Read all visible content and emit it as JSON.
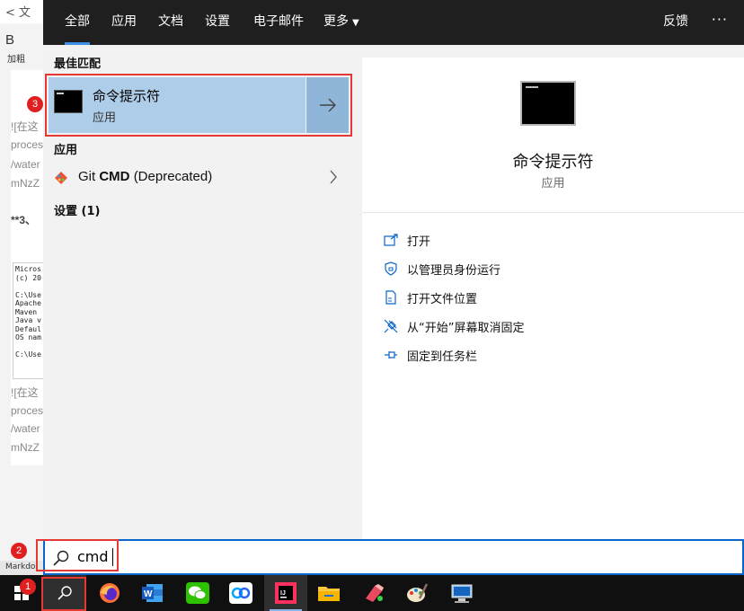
{
  "background_editor": {
    "top_fragment": "< 文",
    "bold_button": "B",
    "bold_label": "加粗",
    "lines": [
      "![在这",
      "proces",
      "/water",
      "mNzZ"
    ],
    "heading_fragment": "**3、",
    "terminal_lines": [
      "Micros",
      "(c) 20",
      "",
      "C:\\Use",
      "Apache",
      "Maven",
      "Java v",
      "Defaul",
      "OS nam",
      "",
      "C:\\Use"
    ],
    "lines_2": [
      "![在这",
      "proces",
      "/water",
      "mNzZ"
    ],
    "status_text": "Markdo"
  },
  "tabs": [
    {
      "label": "全部",
      "active": true
    },
    {
      "label": "应用"
    },
    {
      "label": "文档"
    },
    {
      "label": "设置"
    },
    {
      "label": "电子邮件"
    },
    {
      "label": "更多"
    }
  ],
  "feedback_label": "反馈",
  "more_options": "···",
  "best_match": {
    "heading": "最佳匹配",
    "title": "命令提示符",
    "subtitle": "应用"
  },
  "apps_section": {
    "heading": "应用",
    "item_name": "Git",
    "item_bold": "CMD",
    "item_suffix": "(Deprecated)"
  },
  "settings_section": {
    "heading": "设置 (1)"
  },
  "details": {
    "title": "命令提示符",
    "subtitle": "应用",
    "actions": [
      {
        "label": "打开",
        "icon": "open-window-icon"
      },
      {
        "label": "以管理员身份运行",
        "icon": "shield-icon"
      },
      {
        "label": "打开文件位置",
        "icon": "file-location-icon"
      },
      {
        "label": "从“开始”屏幕取消固定",
        "icon": "unpin-icon"
      },
      {
        "label": "固定到任务栏",
        "icon": "pin-icon"
      }
    ]
  },
  "search": {
    "query": "cmd"
  },
  "callouts": [
    "1",
    "2",
    "3"
  ],
  "taskbar_apps": [
    {
      "name": "firefox"
    },
    {
      "name": "word"
    },
    {
      "name": "wechat"
    },
    {
      "name": "baidu-netdisk"
    },
    {
      "name": "intellij-idea",
      "active": true,
      "label": "IJ"
    },
    {
      "name": "file-explorer"
    },
    {
      "name": "app-paint"
    },
    {
      "name": "paint-palette"
    },
    {
      "name": "remote-desktop"
    }
  ],
  "colors": {
    "accent": "#3d8ee6",
    "selection": "#aecde8",
    "callout_red": "#e02020",
    "topbar": "#1f1f1f"
  }
}
